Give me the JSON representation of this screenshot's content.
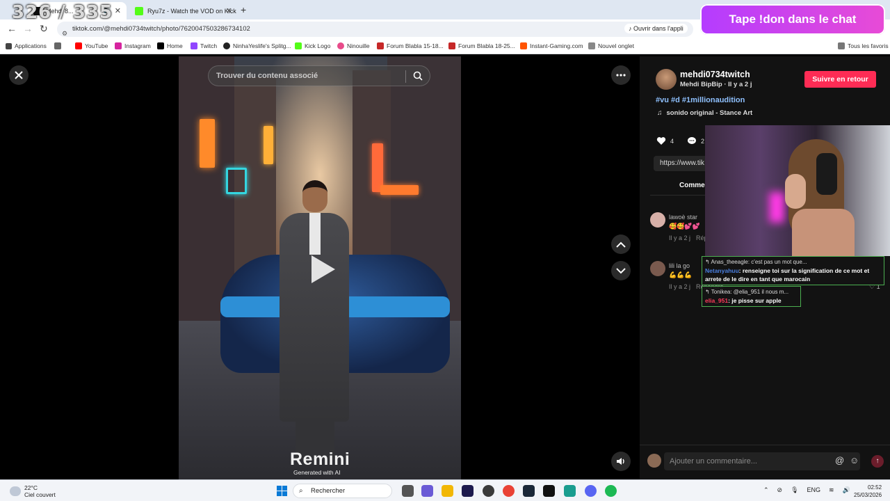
{
  "overlay": {
    "counter": "326 / 335",
    "donation_banner": "Tape !don dans le chat"
  },
  "browser": {
    "tabs": [
      {
        "title": "Mehdi 8...",
        "active": true
      },
      {
        "title": "Ryu7z - Watch the VOD on Kick",
        "active": false
      }
    ],
    "url": "tiktok.com/@mehdi0734twitch/photo/7620047503286734102",
    "open_app_label": "Ouvrir dans l'appli",
    "bookmarks": [
      "Applications",
      "YouTube",
      "Instagram",
      "Home",
      "Twitch",
      "NinhaYeslife's Splitg...",
      "Kick Logo",
      "Ninouille",
      "Forum Blabla 15-18...",
      "Forum Blabla 18-25...",
      "Instant-Gaming.com",
      "Nouvel onglet"
    ],
    "all_favorites": "Tous les favoris"
  },
  "video": {
    "search_placeholder": "Trouver du contenu associé",
    "watermark": "Remini",
    "watermark_sub": "Generated with AI"
  },
  "post": {
    "username": "mehdi0734twitch",
    "subline": "Mehdi BipBip · Il y a 2 j",
    "follow_label": "Suivre en retour",
    "hashtags": "#vu #d #1millionaudition",
    "sound": "sonido original - Stance Art",
    "likes": "4",
    "comments_count": "2",
    "link": "https://www.tik",
    "comments_tab": "Comme"
  },
  "comments": [
    {
      "name": "lawoè star",
      "text": "🥰🥰💕💕",
      "time": "Il y a 2 j",
      "reply": "Rép"
    },
    {
      "name": "lili la go",
      "text": "💪💪💪",
      "time": "Il y a 2 j",
      "reply": "Répondre",
      "likes": "1"
    }
  ],
  "chat": [
    {
      "reply_to": "Anas_theeagle: c'est pas un mot que...",
      "user": "Netanyahuu",
      "message": ": renseigne toi sur la signification de ce mot et arrete de le dire en tant que marocain"
    },
    {
      "reply_to": "Tonikea: @elia_951 il nous m...",
      "user": "elia_951",
      "message": ": je pisse sur apple"
    }
  ],
  "comment_bar": {
    "placeholder": "Ajouter un commentaire..."
  },
  "taskbar": {
    "temp": "22°C",
    "condition": "Ciel couvert",
    "search_label": "Rechercher",
    "lang": "ENG",
    "time": "02:52",
    "date": "25/03/2026"
  },
  "colors": {
    "follow": "#fe2c55",
    "hashtag": "#8fc1ff",
    "chat_border": "#4caf50",
    "donation_start": "#b43cff"
  }
}
